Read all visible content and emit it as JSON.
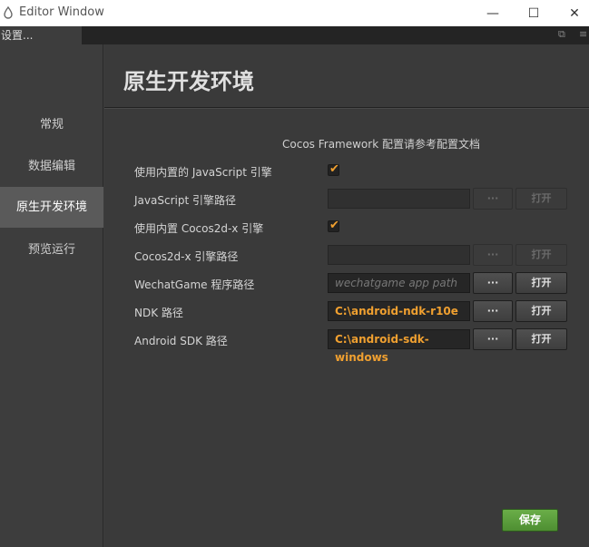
{
  "window": {
    "title": "Editor Window",
    "controls": {
      "minimize": "—",
      "maximize": "☐",
      "close": "✕"
    }
  },
  "tab": {
    "label": "设置..."
  },
  "sidebar": {
    "items": [
      {
        "label": "常规"
      },
      {
        "label": "数据编辑"
      },
      {
        "label": "原生开发环境"
      },
      {
        "label": "预览运行"
      }
    ]
  },
  "page": {
    "title": "原生开发环境",
    "doc_link": "Cocos Framework 配置请参考配置文档"
  },
  "rows": [
    {
      "label": "使用内置的 JavaScript 引擎",
      "type": "checkbox",
      "checked": true
    },
    {
      "label": "JavaScript 引擎路径",
      "type": "path",
      "value": "",
      "enabled": false
    },
    {
      "label": "使用内置 Cocos2d-x 引擎",
      "type": "checkbox",
      "checked": true
    },
    {
      "label": "Cocos2d-x 引擎路径",
      "type": "path",
      "value": "",
      "enabled": false
    },
    {
      "label": "WechatGame 程序路径",
      "type": "path",
      "value": "",
      "placeholder": "wechatgame app path",
      "enabled": true
    },
    {
      "label": "NDK 路径",
      "type": "path",
      "value": "C:\\android-ndk-r10e",
      "enabled": true
    },
    {
      "label": "Android SDK 路径",
      "type": "path",
      "value": "C:\\android-sdk-windows",
      "enabled": true
    }
  ],
  "buttons": {
    "browse": "···",
    "open": "打开",
    "save": "保存"
  },
  "colors": {
    "accent": "#f0a030",
    "save": "#5a9e3c",
    "active_nav": "#5a5a5a"
  }
}
